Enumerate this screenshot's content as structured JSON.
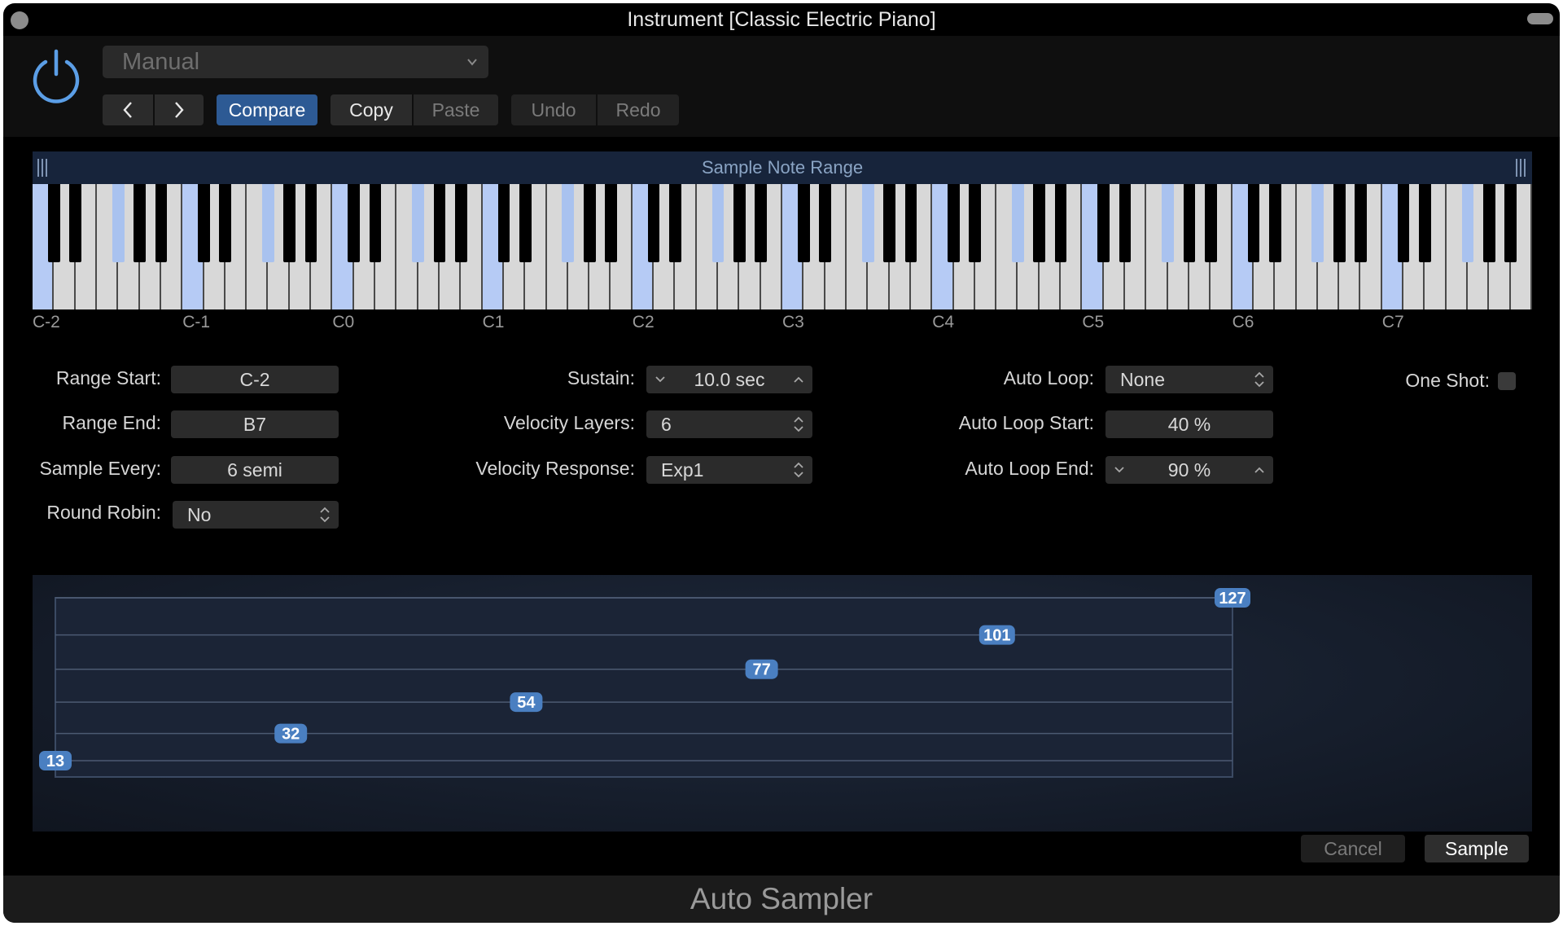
{
  "window": {
    "title": "Instrument [Classic Electric Piano]"
  },
  "toolbar": {
    "preset_value": "Manual",
    "compare_label": "Compare",
    "copy_label": "Copy",
    "paste_label": "Paste",
    "undo_label": "Undo",
    "redo_label": "Redo",
    "accent_color": "#2d5a94"
  },
  "keyboard": {
    "title": "Sample Note Range",
    "octave_labels": [
      "C-2",
      "C-1",
      "C0",
      "C1",
      "C2",
      "C3",
      "C4",
      "C5",
      "C6",
      "C7"
    ],
    "sample_every_semitones": 6,
    "selected_color": "#b6cbf5"
  },
  "params": {
    "range_start": {
      "label": "Range Start:",
      "value": "C-2"
    },
    "range_end": {
      "label": "Range End:",
      "value": "B7"
    },
    "sample_every": {
      "label": "Sample Every:",
      "value": "6 semi"
    },
    "round_robin": {
      "label": "Round Robin:",
      "value": "No"
    },
    "sustain": {
      "label": "Sustain:",
      "value": "10.0 sec"
    },
    "velocity_layers": {
      "label": "Velocity Layers:",
      "value": "6"
    },
    "velocity_response": {
      "label": "Velocity Response:",
      "value": "Exp1"
    },
    "auto_loop": {
      "label": "Auto Loop:",
      "value": "None"
    },
    "auto_loop_start": {
      "label": "Auto Loop Start:",
      "value": "40 %"
    },
    "auto_loop_end": {
      "label": "Auto Loop End:",
      "value": "90 %"
    },
    "one_shot": {
      "label": "One Shot:",
      "checked": false
    }
  },
  "velocity_layers": {
    "values": [
      13,
      32,
      54,
      77,
      101,
      127
    ],
    "max": 127,
    "badge_color": "#4a7fc1"
  },
  "actions": {
    "cancel_label": "Cancel",
    "sample_label": "Sample"
  },
  "footer": {
    "title": "Auto Sampler"
  }
}
